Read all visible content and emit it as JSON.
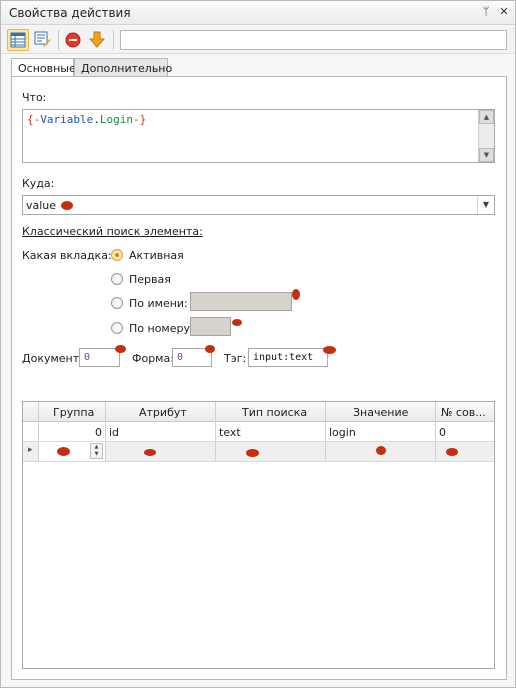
{
  "window": {
    "title": "Свойства действия",
    "pin_glyph": "ᛘ",
    "close_glyph": "✕"
  },
  "toolbar": {
    "icons": [
      "table-icon",
      "edit-list-icon",
      "stop-icon",
      "arrow-down-icon"
    ],
    "field_value": ""
  },
  "tabs": [
    {
      "label": "Основные",
      "selected": true
    },
    {
      "label": "Дополнительно",
      "selected": false
    }
  ],
  "form": {
    "chto_label": "Что:",
    "chto_value": {
      "open": "{-",
      "var": "Variable",
      "dot": ".",
      "login": "Login",
      "close": "-}"
    },
    "kuda_label": "Куда:",
    "kuda_value": "value",
    "section_title": "Классический поиск элемента:",
    "tab_label": "Какая вкладка:",
    "radio_options": [
      {
        "label": "Активная",
        "checked": true
      },
      {
        "label": "Первая",
        "checked": false
      },
      {
        "label": "По имени:",
        "checked": false
      },
      {
        "label": "По номеру:",
        "checked": false
      }
    ],
    "document_label": "Документ:",
    "document_value": "0",
    "form_label": "Форма:",
    "form_value": "0",
    "tag_label": "Тэг:",
    "tag_value": "input:text"
  },
  "grid": {
    "columns": [
      "Группа",
      "Атрибут",
      "Тип поиска",
      "Значение",
      "№ сов..."
    ],
    "rows": [
      [
        "0",
        "id",
        "text",
        "login",
        "0"
      ]
    ],
    "new_row_marker": "▸"
  },
  "colors": {
    "accent": "#e3b949",
    "redaction": "#c42f0f"
  }
}
